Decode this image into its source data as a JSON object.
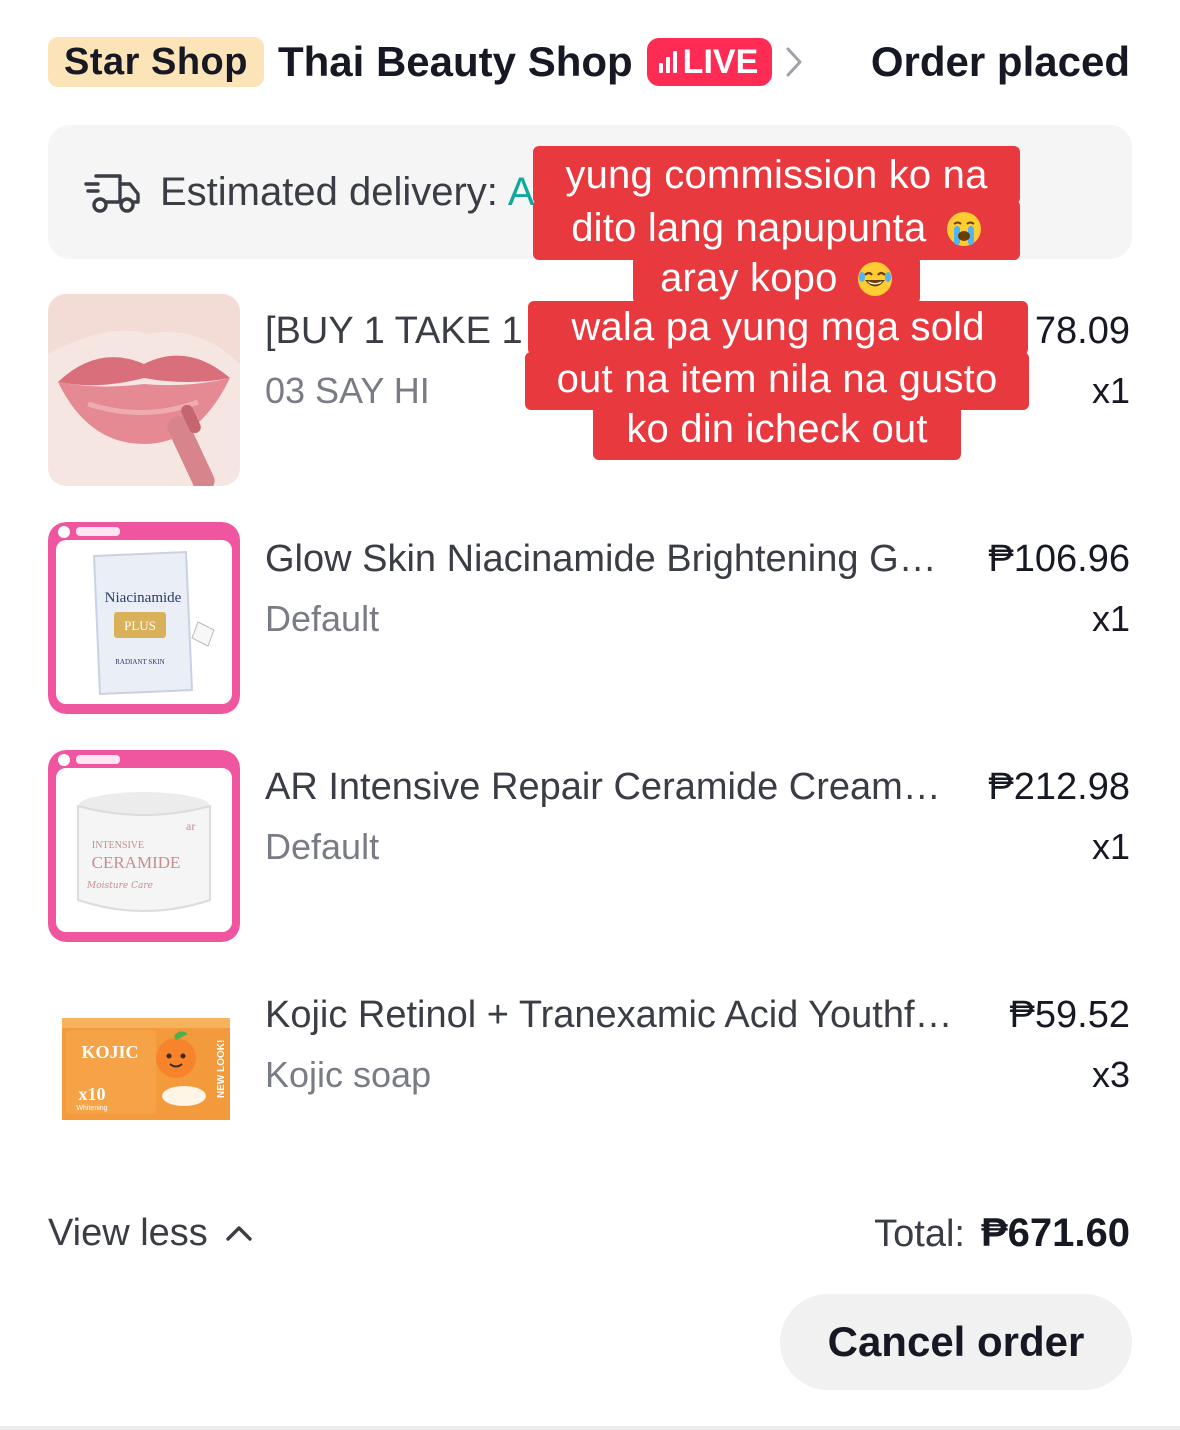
{
  "header": {
    "badge": "Star Shop",
    "shop_name": "Thai Beauty Shop",
    "live_label": "LIVE",
    "status": "Order placed"
  },
  "delivery": {
    "label": "Estimated delivery:",
    "value": "A"
  },
  "items": [
    {
      "name": "[BUY 1 TAKE 1",
      "variant": "03 SAY HI",
      "price": "78.09",
      "qty": "x1",
      "thumb": "lip-gloss-icon"
    },
    {
      "name": "Glow Skin Niacinamide Brightening G…",
      "variant": "Default",
      "price": "₱106.96",
      "qty": "x1",
      "thumb": "niacinamide-soap-icon",
      "thumb_lettering": [
        "Niacinamide",
        "PLUS",
        "RADIANT SKIN"
      ]
    },
    {
      "name": "AR Intensive Repair Ceramide Cream…",
      "variant": "Default",
      "price": "₱212.98",
      "qty": "x1",
      "thumb": "ceramide-jar-icon",
      "thumb_lettering": [
        "INTENSIVE",
        "CERAMIDE",
        "Moisture Care"
      ]
    },
    {
      "name": "Kojic Retinol + Tranexamic Acid Youthf…",
      "variant": "Kojic soap",
      "price": "₱59.52",
      "qty": "x3",
      "thumb": "kojic-soap-icon",
      "thumb_lettering": [
        "KOJIC",
        "x10",
        "Whitening",
        "NEW LOOK!"
      ]
    }
  ],
  "footer": {
    "view_less": "View less",
    "total_label": "Total:",
    "total_value": "₱671.60"
  },
  "actions": {
    "cancel": "Cancel order"
  },
  "overlay": {
    "lines": [
      "yung commission ko na",
      "dito lang napupunta",
      "aray kopo",
      "wala pa yung mga sold",
      "out na item nila na gusto",
      "ko din icheck out"
    ]
  },
  "colors": {
    "live": "#fe2c55",
    "badge_bg": "#fde3b8",
    "overlay_bg": "#e8393f",
    "delivery_accent": "#13a89e",
    "pink_frame": "#f0559f"
  }
}
